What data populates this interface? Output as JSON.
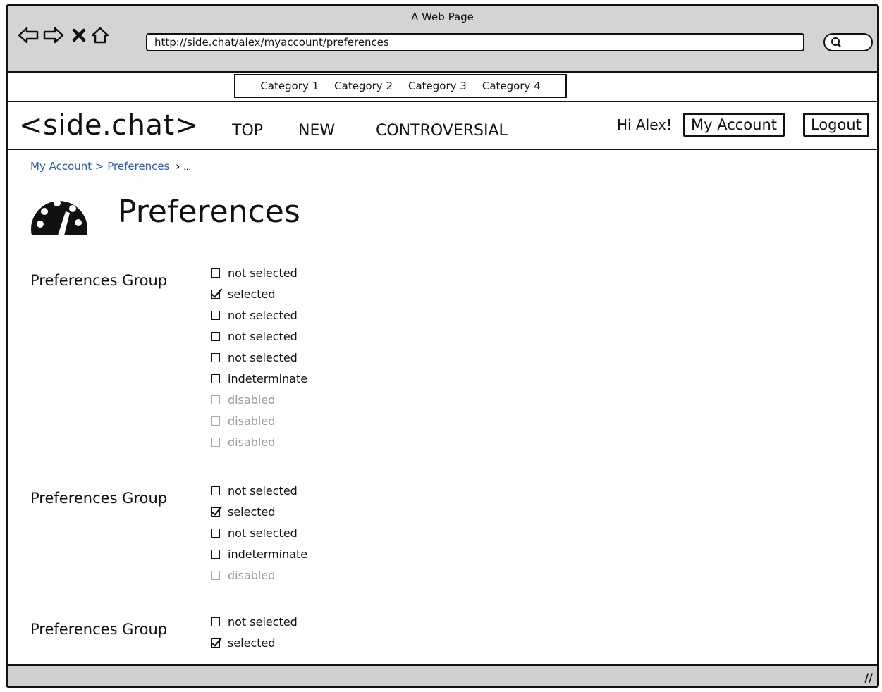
{
  "browser": {
    "window_title": "A Web Page",
    "url": "http://side.chat/alex/myaccount/preferences",
    "icons": [
      "back-arrow-icon",
      "forward-arrow-icon",
      "stop-icon",
      "home-icon",
      "search-icon"
    ]
  },
  "categories": [
    "Category 1",
    "Category 2",
    "Category 3",
    "Category 4"
  ],
  "header": {
    "logo": "<side.chat>",
    "nav": [
      "TOP",
      "NEW",
      "CONTROVERSIAL"
    ],
    "greeting": "Hi Alex!",
    "my_account": "My Account",
    "logout": "Logout"
  },
  "breadcrumb": {
    "link": "My Account > Preferences",
    "separator": "›",
    "ellipsis": "..."
  },
  "page": {
    "title": "Preferences",
    "icon": "dashboard-gauge-icon"
  },
  "groups": [
    {
      "label": "Preferences Group",
      "options": [
        {
          "label": "not selected",
          "state": "unchecked"
        },
        {
          "label": "selected",
          "state": "checked"
        },
        {
          "label": "not selected",
          "state": "unchecked"
        },
        {
          "label": "not selected",
          "state": "unchecked"
        },
        {
          "label": "not selected",
          "state": "unchecked"
        },
        {
          "label": "indeterminate",
          "state": "indeterminate"
        },
        {
          "label": "disabled",
          "state": "disabled"
        },
        {
          "label": "disabled",
          "state": "disabled"
        },
        {
          "label": "disabled",
          "state": "disabled"
        }
      ]
    },
    {
      "label": "Preferences Group",
      "options": [
        {
          "label": "not selected",
          "state": "unchecked"
        },
        {
          "label": "selected",
          "state": "checked"
        },
        {
          "label": "not selected",
          "state": "unchecked"
        },
        {
          "label": "indeterminate",
          "state": "indeterminate"
        },
        {
          "label": "disabled",
          "state": "disabled"
        }
      ]
    },
    {
      "label": "Preferences Group",
      "options": [
        {
          "label": "not selected",
          "state": "unchecked"
        },
        {
          "label": "selected",
          "state": "checked"
        }
      ]
    }
  ],
  "colors": {
    "chrome_bg": "#d4d4d4",
    "link": "#2a5db0",
    "disabled_text": "#999999"
  }
}
